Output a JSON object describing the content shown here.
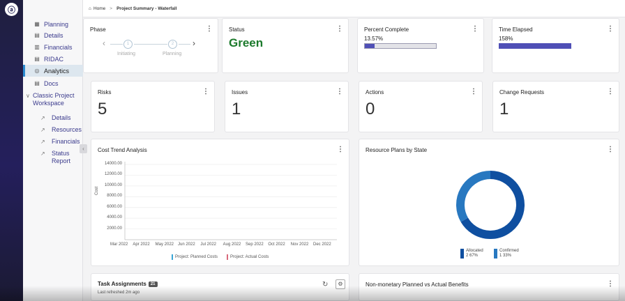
{
  "breadcrumb": {
    "home": "Home",
    "separator": ">",
    "current": "Project Summary - Waterfall"
  },
  "sidebar": {
    "items": [
      {
        "label": "Planning",
        "icon": "grid-icon"
      },
      {
        "label": "Details",
        "icon": "list-icon"
      },
      {
        "label": "Financials",
        "icon": "ledger-icon"
      },
      {
        "label": "RIDAC",
        "icon": "table-icon"
      },
      {
        "label": "Analytics",
        "icon": "analytics-icon",
        "active": true
      },
      {
        "label": "Docs",
        "icon": "doc-icon"
      }
    ],
    "group": {
      "label1": "Classic Project",
      "label2": "Workspace"
    },
    "sub": [
      {
        "label": "Details"
      },
      {
        "label": "Resources"
      },
      {
        "label": "Financials"
      },
      {
        "label": "Status",
        "label2": "Report"
      }
    ],
    "collapse": "‹"
  },
  "cards": {
    "phase": {
      "title": "Phase",
      "step1": "1",
      "step1_label": "Initiating",
      "step2": "2",
      "step2_label": "Planning"
    },
    "status": {
      "title": "Status",
      "value": "Green",
      "color": "#1c7a2c"
    },
    "percent": {
      "title": "Percent Complete",
      "value": "13.57%",
      "fill": 0.1357
    },
    "time": {
      "title": "Time Elapsed",
      "value": "158%",
      "fill": 1.0
    },
    "risks": {
      "title": "Risks",
      "value": "5"
    },
    "issues": {
      "title": "Issues",
      "value": "1"
    },
    "actions": {
      "title": "Actions",
      "value": "0"
    },
    "change": {
      "title": "Change Requests",
      "value": "1"
    },
    "cost": {
      "title": "Cost Trend Analysis",
      "ylabel": "Cost",
      "yticks": [
        "14000.00",
        "12000.00",
        "10000.00",
        "8000.00",
        "6000.00",
        "4000.00",
        "2000.00"
      ],
      "xticks": [
        "Mar 2022",
        "Apr 2022",
        "May 2022",
        "Jun 2022",
        "Jul 2022",
        "Aug 2022",
        "Sep 2022",
        "Oct 2022",
        "Nov 2022",
        "Dec 2022"
      ],
      "legend1": "Project: Planned Costs",
      "legend2": "Project: Actual Costs"
    },
    "resource": {
      "title": "Resource Plans by State"
    },
    "task": {
      "title": "Task Assignments",
      "count": "21",
      "refreshed": "Last refreshed 2m ago"
    },
    "benefits": {
      "title": "Non-monetary Planned vs Actual Benefits"
    }
  },
  "chart_data": [
    {
      "type": "line",
      "title": "Cost Trend Analysis",
      "xlabel": "",
      "ylabel": "Cost",
      "categories": [
        "Mar 2022",
        "Apr 2022",
        "May 2022",
        "Jun 2022",
        "Jul 2022",
        "Aug 2022",
        "Sep 2022",
        "Oct 2022",
        "Nov 2022",
        "Dec 2022"
      ],
      "ylim": [
        0,
        14000
      ],
      "grid": true,
      "legend": "bottom",
      "series": [
        {
          "name": "Project: Planned Costs",
          "values": [],
          "color": "#3aa6d6"
        },
        {
          "name": "Project: Actual Costs",
          "values": [],
          "color": "#d96a7c"
        }
      ]
    },
    {
      "type": "pie",
      "title": "Resource Plans by State",
      "legend": "bottom",
      "categories": [
        "Allocated",
        "Confirmed"
      ],
      "values": [
        2,
        1
      ],
      "labels": [
        "2 67%",
        "1 33%"
      ],
      "colors": [
        "#0f4fa0",
        "#2878c0"
      ]
    }
  ]
}
